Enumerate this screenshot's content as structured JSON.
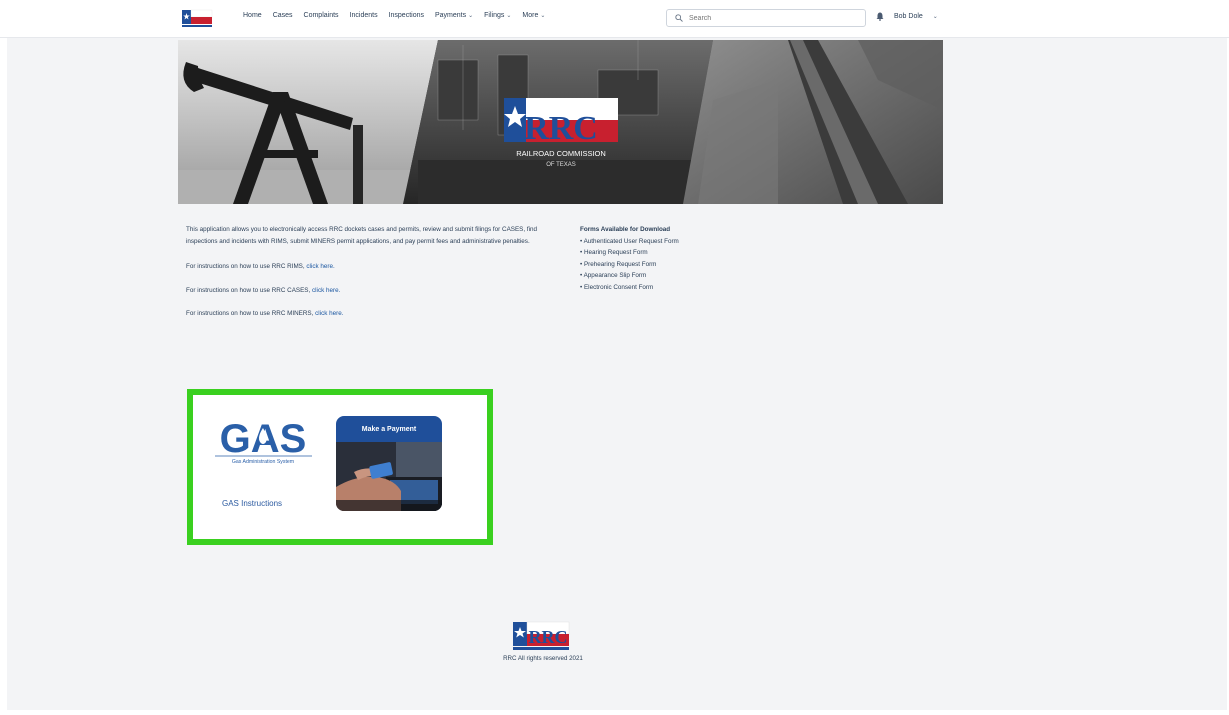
{
  "nav": {
    "items": [
      {
        "label": "Home",
        "dropdown": false
      },
      {
        "label": "Cases",
        "dropdown": false
      },
      {
        "label": "Complaints",
        "dropdown": false
      },
      {
        "label": "Incidents",
        "dropdown": false
      },
      {
        "label": "Inspections",
        "dropdown": false
      },
      {
        "label": "Payments",
        "dropdown": true
      },
      {
        "label": "Filings",
        "dropdown": true
      },
      {
        "label": "More",
        "dropdown": true
      }
    ],
    "search_placeholder": "Search",
    "user_name": "Bob Dole"
  },
  "intro": {
    "paragraph": "This application allows you to electronically access RRC dockets cases and permits, review and submit filings for CASES, find inspections and incidents with RIMS, submit MINERS permit applications, and pay permit fees and administrative penalties.",
    "instructions": [
      {
        "prefix": "For instructions on how to use RRC RIMS, ",
        "link": "click here."
      },
      {
        "prefix": "For instructions on how to use RRC CASES, ",
        "link": "click here."
      },
      {
        "prefix": "For instructions on how to use RRC MINERS, ",
        "link": "click here."
      }
    ]
  },
  "forms": {
    "heading": "Forms Available for Download",
    "items": [
      "Authenticated User Request Form",
      "Hearing Request Form",
      "Prehearing Request Form",
      "Appearance Slip Form",
      "Electronic Consent Form"
    ]
  },
  "gas_tile": {
    "logo_text": "GAS",
    "logo_subtitle": "Gas Administration System",
    "instructions_label": "GAS Instructions"
  },
  "payment_tile": {
    "label": "Make a Payment"
  },
  "hero": {
    "logo_text": "RRC",
    "caption_line1": "RAILROAD COMMISSION",
    "caption_line2": "OF TEXAS"
  },
  "footer": {
    "logo_text": "RRC",
    "copyright": "RRC All rights reserved 2021"
  },
  "colors": {
    "highlight": "#3ad01f",
    "brand_blue": "#1f4f9a",
    "brand_red": "#c8202f"
  }
}
